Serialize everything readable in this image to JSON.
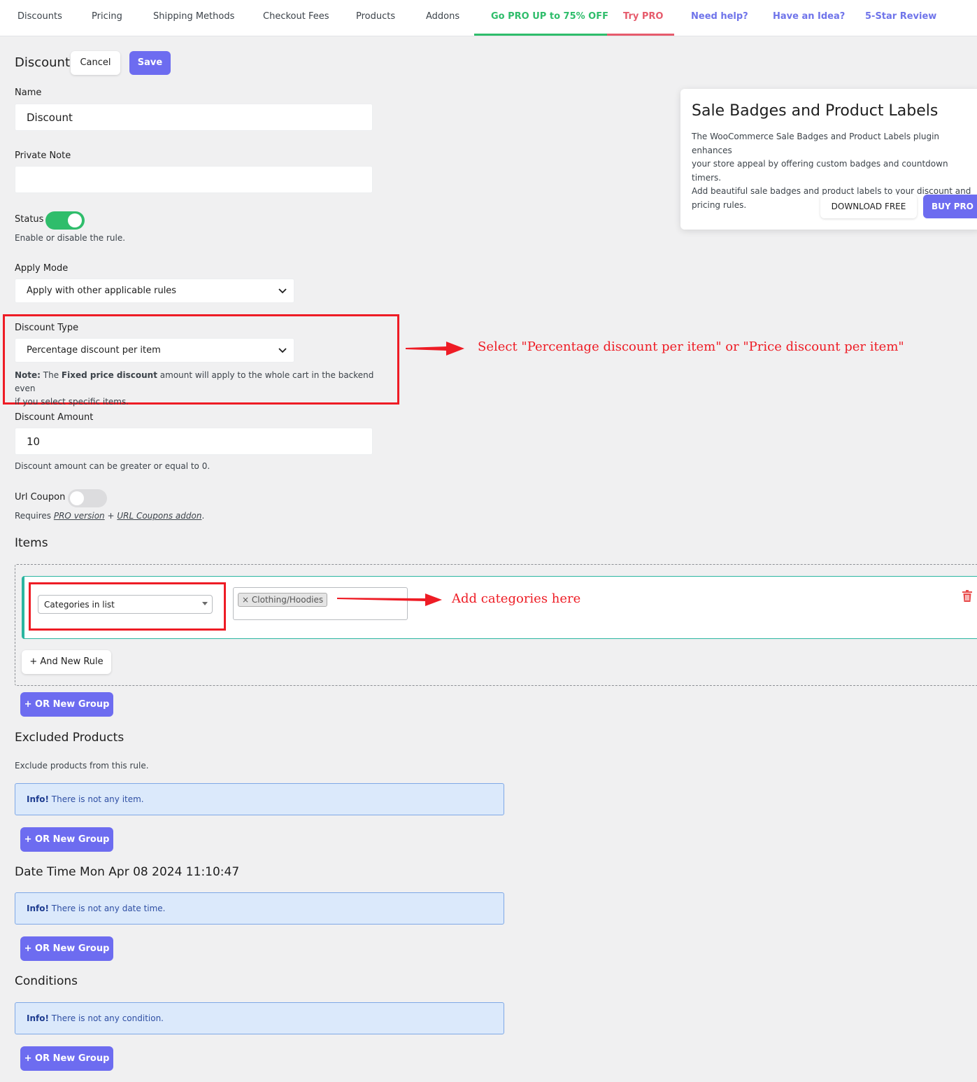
{
  "nav": {
    "tabs": [
      {
        "label": "Discounts"
      },
      {
        "label": "Pricing"
      },
      {
        "label": "Shipping Methods"
      },
      {
        "label": "Checkout Fees"
      },
      {
        "label": "Products"
      },
      {
        "label": "Addons"
      },
      {
        "label": "Go PRO UP to 75% OFF"
      },
      {
        "label": "Try PRO"
      },
      {
        "label": "Need help?"
      },
      {
        "label": "Have an Idea?"
      },
      {
        "label": "5-Star Review"
      }
    ],
    "colors": {
      "green": "#2fbd6b",
      "red": "#e65b6c",
      "blue": "#6f74ea"
    }
  },
  "header": {
    "title": "Discount",
    "cancel_label": "Cancel",
    "save_label": "Save"
  },
  "form": {
    "name_label": "Name",
    "name_value": "Discount",
    "private_note_label": "Private Note",
    "private_note_value": "",
    "status_label": "Status",
    "status_on": true,
    "status_help": "Enable or disable the rule.",
    "apply_mode_label": "Apply Mode",
    "apply_mode_value": "Apply with other applicable rules",
    "discount_type_label": "Discount Type",
    "discount_type_value": "Percentage discount per item",
    "note_prefix": "Note:",
    "note_text1": " The ",
    "note_bold": "Fixed price discount",
    "note_text2": " amount will apply to the whole cart in the backend even",
    "note_text3": "if you select specific items.",
    "discount_amount_label": "Discount Amount",
    "discount_amount_value": "10",
    "discount_amount_help": "Discount amount can be greater or equal to 0.",
    "url_coupon_label": "Url Coupon",
    "url_coupon_on": false,
    "url_coupon_help_prefix": "Requires ",
    "url_coupon_link1": "PRO version",
    "url_coupon_help_mid": " + ",
    "url_coupon_link2": "URL Coupons addon",
    "url_coupon_help_suffix": "."
  },
  "items": {
    "title": "Items",
    "rule_type": "Categories in list",
    "tag": "Clothing/Hoodies",
    "tag_remove": "×",
    "and_rule_label": "+ And New Rule",
    "or_group_label": "+ OR New Group"
  },
  "excluded": {
    "title": "Excluded Products",
    "help": "Exclude products from this rule.",
    "info_prefix": "Info!",
    "info_text": " There is not any item.",
    "or_group_label": "+ OR New Group"
  },
  "datetime": {
    "title": "Date Time Mon Apr 08 2024 11:10:47",
    "info_prefix": "Info!",
    "info_text": " There is not any date time.",
    "or_group_label": "+ OR New Group"
  },
  "conditions": {
    "title": "Conditions",
    "info_prefix": "Info!",
    "info_text": " There is not any condition.",
    "or_group_label": "+ OR New Group"
  },
  "promo": {
    "title": "Sale Badges and Product Labels",
    "line1": "The WooCommerce Sale Badges and Product Labels plugin enhances",
    "line2": "your store appeal by offering custom badges and countdown timers.",
    "line3": "Add beautiful sale badges and product labels to your discount and",
    "line4": "pricing rules.",
    "download_label": "DOWNLOAD FREE",
    "buy_label": "BUY PRO"
  },
  "annotations": {
    "discount_type_hint": "Select \"Percentage discount per item\" or \"Price discount per item\"",
    "categories_hint": "Add categories here",
    "color": "#ee1c25"
  },
  "icons": {
    "delete": "trash-icon",
    "dropdown": "chevron-down-icon"
  }
}
